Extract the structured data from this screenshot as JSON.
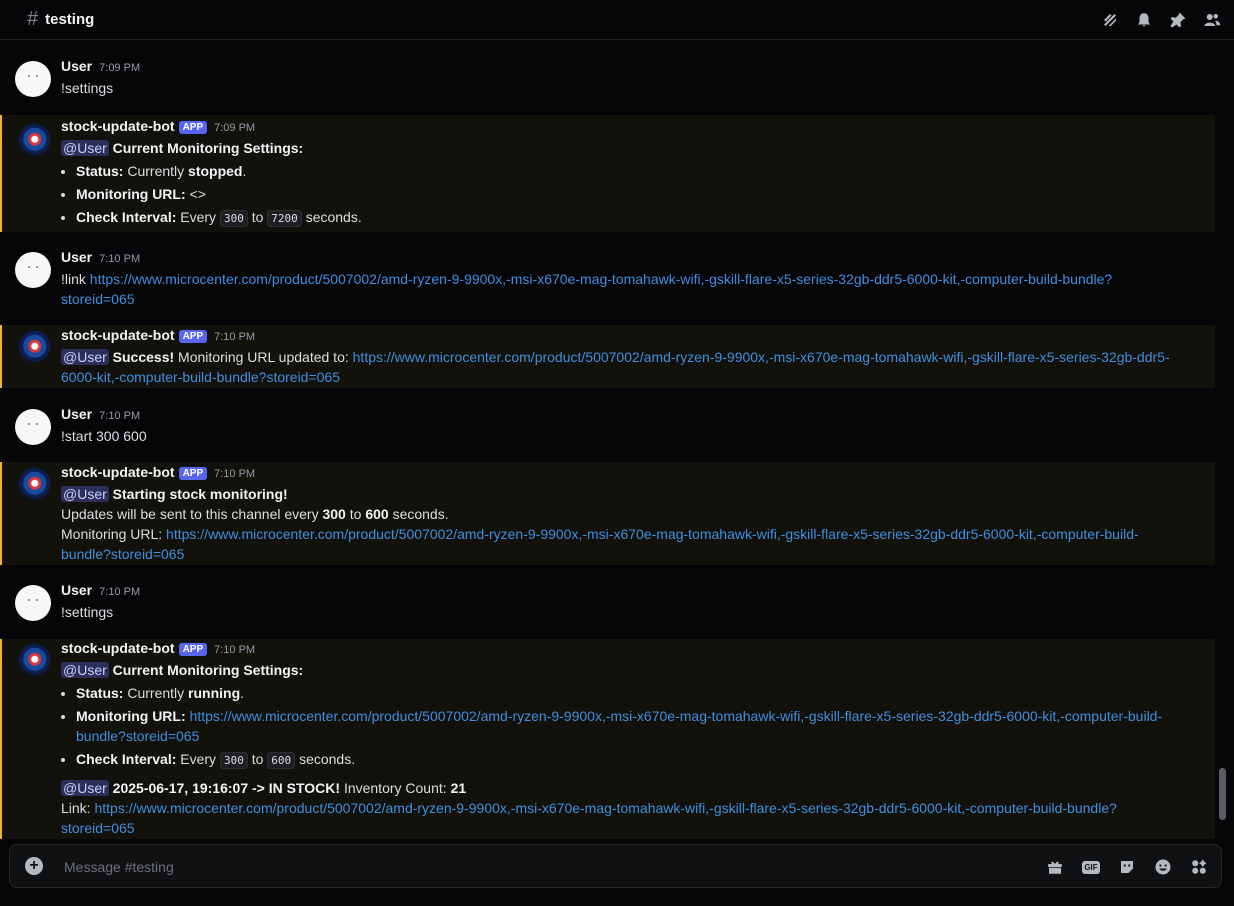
{
  "header": {
    "hash": "#",
    "channel": "testing",
    "icons": [
      "threads-icon",
      "bell-icon",
      "pin-icon",
      "members-icon"
    ]
  },
  "messages": [
    {
      "author": "User",
      "time": "7:09 PM",
      "text": "!settings"
    },
    {
      "author": "stock-update-bot",
      "tag": "APP",
      "time": "7:09 PM",
      "mention": "@User",
      "title": "Current Monitoring Settings:",
      "bullets": {
        "status_label": "Status:",
        "status_pre": "Currently",
        "status_value": "stopped",
        "status_end": ".",
        "url_label": "Monitoring URL:",
        "url_value": "<>",
        "interval_label": "Check Interval:",
        "interval_pre": "Every",
        "interval_min": "300",
        "interval_mid": "to",
        "interval_max": "7200",
        "interval_end": "seconds."
      }
    },
    {
      "author": "User",
      "time": "7:10 PM",
      "cmd": "!link",
      "url_line1": "https://www.microcenter.com/product/5007002/amd-ryzen-9-9900x,-msi-x670e-mag-tomahawk-wifi,-gskill-flare-x5-series-32gb-ddr5-6000-kit,-computer-build-bundle?",
      "url_line2": "storeid=065"
    },
    {
      "author": "stock-update-bot",
      "tag": "APP",
      "time": "7:10 PM",
      "mention": "@User",
      "title": "Success!",
      "text": "Monitoring URL updated to:",
      "url_line1": "https://www.microcenter.com/product/5007002/amd-ryzen-9-9900x,-msi-x670e-mag-tomahawk-wifi,-gskill-flare-x5-series-32gb-ddr5-",
      "url_line2": "6000-kit,-computer-build-bundle?storeid=065"
    },
    {
      "author": "User",
      "time": "7:10 PM",
      "text": "!start 300 600"
    },
    {
      "author": "stock-update-bot",
      "tag": "APP",
      "time": "7:10 PM",
      "mention": "@User",
      "title": "Starting stock monitoring!",
      "updates_pre": "Updates will be sent to this channel every",
      "updates_min": "300",
      "updates_mid": "to",
      "updates_max": "600",
      "updates_end": "seconds.",
      "url_label": "Monitoring URL:",
      "url_line1": "https://www.microcenter.com/product/5007002/amd-ryzen-9-9900x,-msi-x670e-mag-tomahawk-wifi,-gskill-flare-x5-series-32gb-ddr5-6000-kit,-computer-build-",
      "url_line2": "bundle?storeid=065"
    },
    {
      "author": "User",
      "time": "7:10 PM",
      "text": "!settings"
    },
    {
      "author": "stock-update-bot",
      "tag": "APP",
      "time": "7:10 PM",
      "mention": "@User",
      "title": "Current Monitoring Settings:",
      "bullets": {
        "status_label": "Status:",
        "status_pre": "Currently",
        "status_value": "running",
        "status_end": ".",
        "url_label": "Monitoring URL:",
        "url_line1": "https://www.microcenter.com/product/5007002/amd-ryzen-9-9900x,-msi-x670e-mag-tomahawk-wifi,-gskill-flare-x5-series-32gb-ddr5-6000-kit,-computer-build-",
        "url_line2": "bundle?storeid=065",
        "interval_label": "Check Interval:",
        "interval_pre": "Every",
        "interval_min": "300",
        "interval_mid": "to",
        "interval_max": "600",
        "interval_end": "seconds."
      },
      "stock": {
        "mention": "@User",
        "stamp": "2025-06-17, 19:16:07 ->",
        "state": "IN STOCK!",
        "count_label": "Inventory Count:",
        "count": "21",
        "link_label": "Link:",
        "url_line1": "https://www.microcenter.com/product/5007002/amd-ryzen-9-9900x,-msi-x670e-mag-tomahawk-wifi,-gskill-flare-x5-series-32gb-ddr5-6000-kit,-computer-build-bundle?",
        "url_line2": "storeid=065"
      }
    }
  ],
  "composer": {
    "placeholder": "Message #testing",
    "gif_label": "GIF",
    "icons": [
      "add-icon",
      "gift-icon",
      "gif-icon",
      "sticker-icon",
      "emoji-icon",
      "apps-icon"
    ]
  },
  "colors": {
    "accent": "#5865f2",
    "link": "#3f8fe0",
    "bot_border": "#f0b232"
  }
}
